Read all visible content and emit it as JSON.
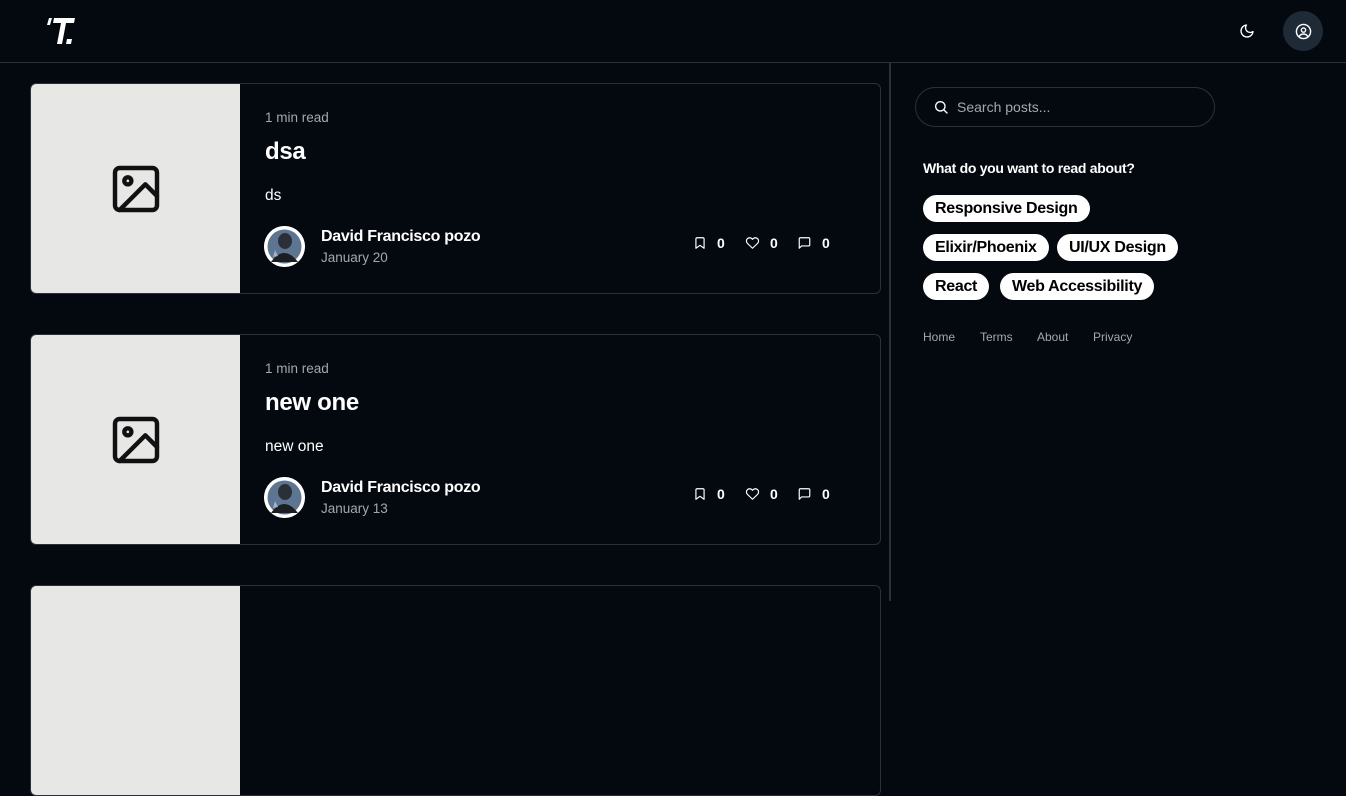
{
  "header": {
    "logo_alt": "T.",
    "theme_toggle_icon": "moon-icon",
    "user_menu_icon": "user-circle-icon"
  },
  "posts": [
    {
      "read_time": "1 min read",
      "title": "dsa",
      "excerpt": "ds",
      "author": "David Francisco pozo",
      "date": "January 20",
      "bookmarks": "0",
      "likes": "0",
      "comments": "0"
    },
    {
      "read_time": "1 min read",
      "title": "new one",
      "excerpt": "new one",
      "author": "David Francisco pozo",
      "date": "January 13",
      "bookmarks": "0",
      "likes": "0",
      "comments": "0"
    },
    {
      "read_time": "",
      "title": "",
      "excerpt": "",
      "author": "",
      "date": "",
      "bookmarks": "",
      "likes": "",
      "comments": ""
    }
  ],
  "sidebar": {
    "search_placeholder": "Search posts...",
    "topics_heading": "What do you want to read about?",
    "topics": [
      "Responsive Design",
      "Elixir/Phoenix",
      "UI/UX Design",
      "React",
      "Web Accessibility"
    ],
    "footer_links": [
      "Home",
      "Terms",
      "About",
      "Privacy"
    ]
  },
  "colors": {
    "background": "#040910",
    "border": "#2b313a",
    "muted_text": "#a3a8b0",
    "thumb_bg": "#e7e7e6",
    "chip_bg": "#ffffff"
  }
}
